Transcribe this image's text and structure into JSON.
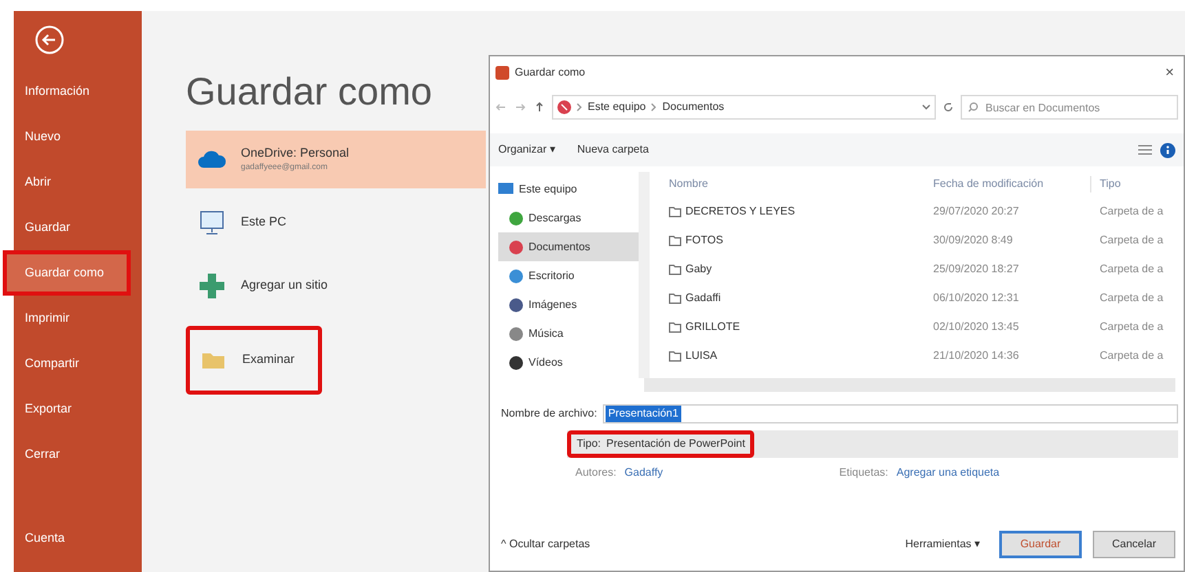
{
  "sidebar": {
    "items": [
      {
        "label": "Información",
        "selected": false,
        "highlighted": false
      },
      {
        "label": "Nuevo",
        "selected": false,
        "highlighted": false
      },
      {
        "label": "Abrir",
        "selected": false,
        "highlighted": false
      },
      {
        "label": "Guardar",
        "selected": false,
        "highlighted": false
      },
      {
        "label": "Guardar como",
        "selected": true,
        "highlighted": true
      },
      {
        "label": "Imprimir",
        "selected": false,
        "highlighted": false
      },
      {
        "label": "Compartir",
        "selected": false,
        "highlighted": false
      },
      {
        "label": "Exportar",
        "selected": false,
        "highlighted": false
      },
      {
        "label": "Cerrar",
        "selected": false,
        "highlighted": false
      }
    ],
    "footer_item": "Cuenta"
  },
  "title": "Guardar como",
  "places": [
    {
      "kind": "cloud",
      "label": "OneDrive: Personal",
      "sublabel": "gadaffyeee@gmail.com",
      "selected": true,
      "highlighted": false
    },
    {
      "kind": "pc",
      "label": "Este PC",
      "selected": false,
      "highlighted": false
    },
    {
      "kind": "add",
      "label": "Agregar un sitio",
      "selected": false,
      "highlighted": false
    },
    {
      "kind": "folder",
      "label": "Examinar",
      "selected": false,
      "highlighted": true
    }
  ],
  "dialog": {
    "title": "Guardar como",
    "close": "×",
    "path": [
      "Este equipo",
      "Documentos"
    ],
    "search": {
      "placeholder": "Buscar en Documentos"
    },
    "toolbar": {
      "organize": "Organizar ▾",
      "new_folder": "Nueva carpeta"
    },
    "nav_items": [
      {
        "label": "Este equipo",
        "kind": "pc",
        "selected": false
      },
      {
        "label": "Descargas",
        "kind": "downloads",
        "selected": false
      },
      {
        "label": "Documentos",
        "kind": "documents",
        "selected": true
      },
      {
        "label": "Escritorio",
        "kind": "desktop",
        "selected": false
      },
      {
        "label": "Imágenes",
        "kind": "images",
        "selected": false
      },
      {
        "label": "Música",
        "kind": "music",
        "selected": false
      },
      {
        "label": "Vídeos",
        "kind": "videos",
        "selected": false
      }
    ],
    "columns": [
      "Nombre",
      "Fecha de modificación",
      "Tipo"
    ],
    "rows": [
      {
        "name": "DECRETOS Y LEYES",
        "date": "29/07/2020 20:27",
        "type": "Carpeta de a"
      },
      {
        "name": "FOTOS",
        "date": "30/09/2020 8:49",
        "type": "Carpeta de a"
      },
      {
        "name": "Gaby",
        "date": "25/09/2020 18:27",
        "type": "Carpeta de a"
      },
      {
        "name": "Gadaffi",
        "date": "06/10/2020 12:31",
        "type": "Carpeta de a"
      },
      {
        "name": "GRILLOTE",
        "date": "02/10/2020 13:45",
        "type": "Carpeta de a"
      },
      {
        "name": "LUISA",
        "date": "21/10/2020 14:36",
        "type": "Carpeta de a"
      }
    ],
    "filename": {
      "label": "Nombre de archivo:",
      "value": "Presentación1"
    },
    "filetype": {
      "label": "Tipo:",
      "value": "Presentación de PowerPoint",
      "highlighted": true
    },
    "authors": {
      "label": "Autores:",
      "value": "Gadaffy"
    },
    "tags": {
      "label": "Etiquetas:",
      "value": "Agregar una etiqueta"
    },
    "hide_folders": "^ Ocultar carpetas",
    "tools": "Herramientas ▾",
    "buttons": [
      "Guardar",
      "Cancelar"
    ]
  }
}
